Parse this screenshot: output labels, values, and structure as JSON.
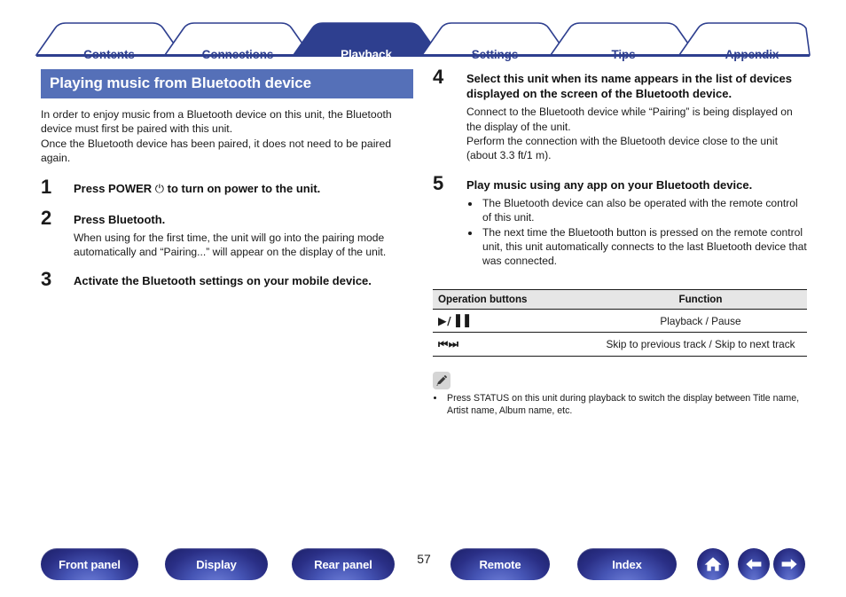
{
  "tabs": [
    {
      "label": "Contents",
      "active": false
    },
    {
      "label": "Connections",
      "active": false
    },
    {
      "label": "Playback",
      "active": true
    },
    {
      "label": "Settings",
      "active": false
    },
    {
      "label": "Tips",
      "active": false
    },
    {
      "label": "Appendix",
      "active": false
    }
  ],
  "colors": {
    "tab_active_bg": "#2e3f8f",
    "tab_text": "#2e3f8f",
    "heading_bg": "#5570b8",
    "pill_bg": "#2a2f86",
    "table_header_bg": "#e6e6e6"
  },
  "heading": "Playing music from Bluetooth device",
  "intro": [
    "In order to enjoy music from a Bluetooth device on this unit, the Bluetooth device must first be paired with this unit.",
    "Once the Bluetooth device has been paired, it does not need to be paired again."
  ],
  "steps_left": [
    {
      "num": "1",
      "title_pre": "Press POWER ",
      "title_sym": "⏻",
      "title_post": " to turn on power to the unit.",
      "body": []
    },
    {
      "num": "2",
      "title_pre": "Press Bluetooth.",
      "title_sym": "",
      "title_post": "",
      "body": [
        "When using for the first time, the unit will go into the pairing mode automatically and “Pairing...” will appear on the display of the unit."
      ]
    },
    {
      "num": "3",
      "title_pre": "Activate the Bluetooth settings on your mobile device.",
      "title_sym": "",
      "title_post": "",
      "body": []
    }
  ],
  "steps_right": [
    {
      "num": "4",
      "title": "Select this unit when its name appears in the list of devices displayed on the screen of the Bluetooth device.",
      "body": [
        "Connect to the Bluetooth device while “Pairing” is being displayed on the display of the unit.",
        "Perform the connection with the Bluetooth device close to the unit (about 3.3 ft/1 m)."
      ],
      "bullets": []
    },
    {
      "num": "5",
      "title": "Play music using any app on your Bluetooth device.",
      "body": [],
      "bullets": [
        "The Bluetooth device can also be operated with the remote control of this unit.",
        "The next time the Bluetooth button is pressed on the remote control unit, this unit automatically connects to the last Bluetooth device that was connected."
      ]
    }
  ],
  "table": {
    "headers": {
      "col1": "Operation buttons",
      "col2": "Function"
    },
    "rows": [
      {
        "buttons": "▶/▐▐",
        "function": "Playback / Pause"
      },
      {
        "buttons": "⏮⏭",
        "function": "Skip to previous track / Skip to next track"
      }
    ]
  },
  "note": {
    "icon": "pencil-icon",
    "items": [
      "Press STATUS on this unit during playback to switch the display between Title name, Artist name, Album name, etc."
    ]
  },
  "footer": {
    "buttons": [
      {
        "label": "Front panel"
      },
      {
        "label": "Display"
      },
      {
        "label": "Rear panel"
      },
      {
        "label": "Remote"
      },
      {
        "label": "Index"
      }
    ],
    "page_number": "57",
    "icons": [
      {
        "name": "home-icon"
      },
      {
        "name": "arrow-left-icon"
      },
      {
        "name": "arrow-right-icon"
      }
    ]
  }
}
